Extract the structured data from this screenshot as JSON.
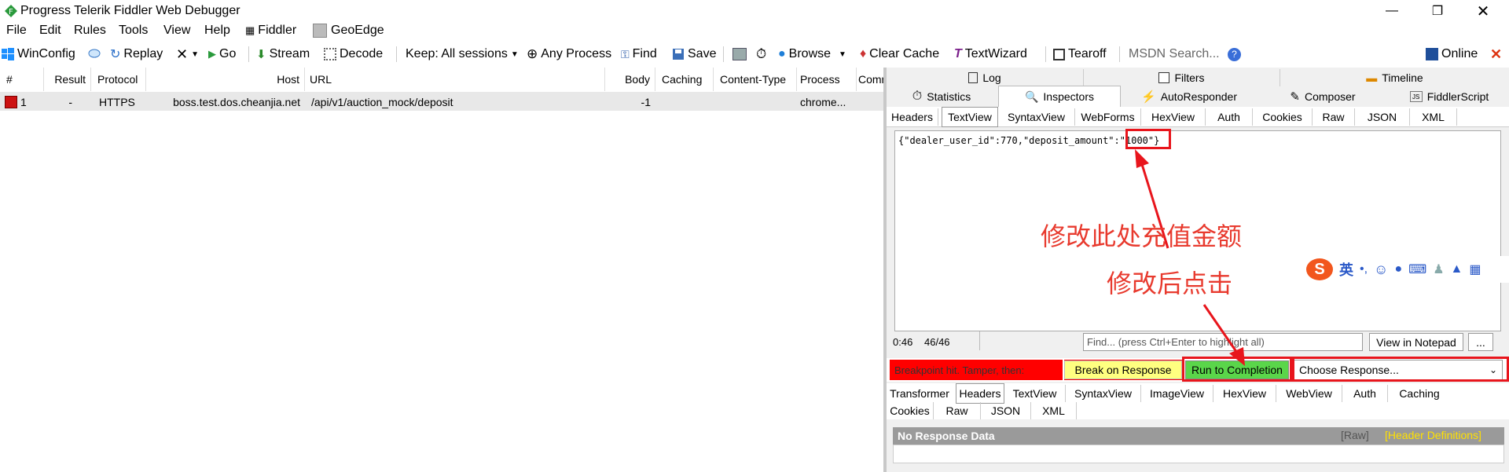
{
  "window": {
    "title": "Progress Telerik Fiddler Web Debugger"
  },
  "menu": [
    "File",
    "Edit",
    "Rules",
    "Tools",
    "View",
    "Help"
  ],
  "menu_extra": {
    "fiddler": "Fiddler",
    "geoedge": "GeoEdge"
  },
  "toolbar": {
    "winconfig": "WinConfig",
    "replay": "Replay",
    "go": "Go",
    "stream": "Stream",
    "decode": "Decode",
    "keep": "Keep: All sessions",
    "any_process": "Any Process",
    "find": "Find",
    "save": "Save",
    "browse": "Browse",
    "clear_cache": "Clear Cache",
    "textwizard": "TextWizard",
    "tearoff": "Tearoff",
    "msdn_placeholder": "MSDN Search...",
    "online": "Online"
  },
  "sessions": {
    "columns": [
      "#",
      "Result",
      "Protocol",
      "Host",
      "URL",
      "Body",
      "Caching",
      "Content-Type",
      "Process",
      "Comm"
    ],
    "rows": [
      {
        "num": "1",
        "result": "-",
        "protocol": "HTTPS",
        "host": "boss.test.dos.cheanjia.net",
        "url": "/api/v1/auction_mock/deposit",
        "body": "-1",
        "caching": "",
        "content_type": "",
        "process": "chrome..."
      }
    ]
  },
  "right_tabs_row1": [
    "Log",
    "Filters",
    "Timeline"
  ],
  "right_tabs_row2": [
    "Statistics",
    "Inspectors",
    "AutoResponder",
    "Composer",
    "FiddlerScript"
  ],
  "request_tabs": [
    "Headers",
    "TextView",
    "SyntaxView",
    "WebForms",
    "HexView",
    "Auth",
    "Cookies",
    "Raw",
    "JSON",
    "XML"
  ],
  "request_body_prefix": "{\"dealer_user_id\":770,\"deposit_amount\":",
  "request_body_value": "\"1000\"}",
  "annotations": {
    "line1": "修改此处充值金额",
    "line2": "修改后点击"
  },
  "ime": {
    "label": "英"
  },
  "status": {
    "pos": "0:46",
    "count": "46/46",
    "find_placeholder": "Find... (press Ctrl+Enter to highlight all)",
    "notepad": "View in Notepad",
    "more": "..."
  },
  "breakpoint": {
    "text": "Breakpoint hit. Tamper, then:",
    "break_on_response": "Break on Response",
    "run_to_completion": "Run to Completion",
    "choose_response": "Choose Response..."
  },
  "response_tabs_row1": [
    "Transformer",
    "Headers",
    "TextView",
    "SyntaxView",
    "ImageView",
    "HexView",
    "WebView",
    "Auth",
    "Caching"
  ],
  "response_tabs_row2": [
    "Cookies",
    "Raw",
    "JSON",
    "XML"
  ],
  "response": {
    "no_data": "No Response Data",
    "raw": "[Raw]",
    "header_defs": "[Header Definitions]"
  },
  "colors": {
    "accent_red": "#e8151c",
    "breakpoint_red": "#ff0000",
    "yellow_btn": "#ffff80",
    "green_btn": "#5ad64a",
    "annotation": "#e83a2e"
  }
}
